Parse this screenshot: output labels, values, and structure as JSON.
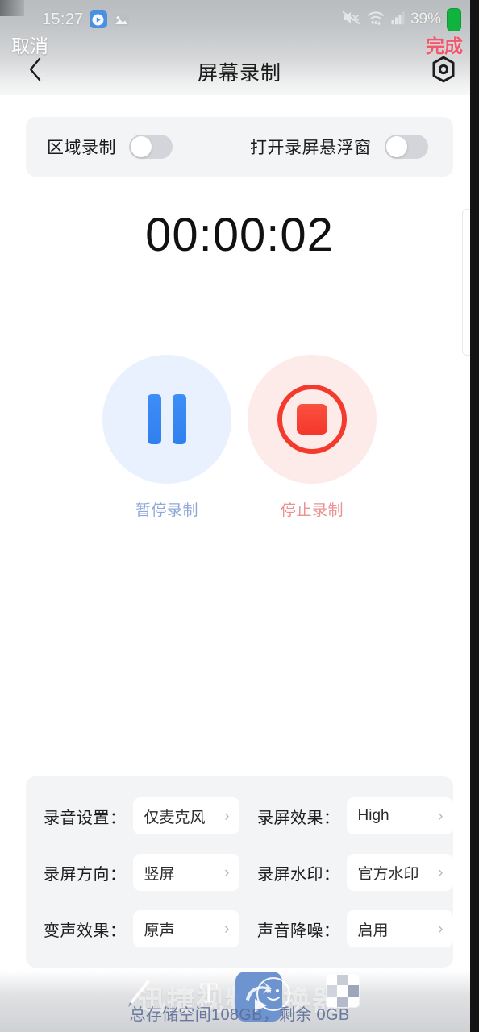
{
  "status_bar": {
    "time": "15:27",
    "app_icon": "screen-record-app-icon",
    "gallery_icon": "image-icon",
    "mute_icon": "volume-mute-icon",
    "wifi_icon": "wifi-data-icon",
    "signal_icon": "cellular-signal-icon",
    "battery_percent": "39%",
    "battery_icon": "battery-full-icon",
    "battery_color": "#11b33f"
  },
  "overlay_actions": {
    "cancel_label": "取消",
    "done_label": "完成",
    "done_color": "#f4566b"
  },
  "navbar": {
    "back_icon": "chevron-left-icon",
    "title": "屏幕录制",
    "settings_icon": "gear-hexagon-icon"
  },
  "toggles": [
    {
      "label": "区域录制",
      "value": "off",
      "icon": "toggle-switch-off"
    },
    {
      "label": "打开录屏悬浮窗",
      "value": "off",
      "icon": "toggle-switch-off"
    }
  ],
  "timer": {
    "elapsed": "00:00:02"
  },
  "controls": [
    {
      "label": "暂停录制",
      "icon": "pause-icon",
      "accent": "#2f7ff0",
      "bg": "#e8f1fd",
      "label_color": "#8fa8d8"
    },
    {
      "label": "停止录制",
      "icon": "stop-record-icon",
      "accent": "#f43a2d",
      "bg": "#fdebea",
      "label_color": "#e99193"
    }
  ],
  "settings": {
    "rows": [
      {
        "left": {
          "label": "录音设置：",
          "value": "仅麦克风",
          "chevron": "chevron-right-icon"
        },
        "right": {
          "label": "录屏效果：",
          "value": "High",
          "chevron": "chevron-right-icon"
        }
      },
      {
        "left": {
          "label": "录屏方向：",
          "value": "竖屏",
          "chevron": "chevron-right-icon"
        },
        "right": {
          "label": "录屏水印：",
          "value": "官方水印",
          "chevron": "chevron-right-icon"
        }
      },
      {
        "left": {
          "label": "变声效果：",
          "value": "原声",
          "chevron": "chevron-right-icon"
        },
        "right": {
          "label": "声音降噪：",
          "value": "启用",
          "chevron": "chevron-right-icon"
        }
      }
    ]
  },
  "storage": {
    "text": "总存储空间108GB，剩余 0GB"
  },
  "bottom_overlay": {
    "ghost_brand": "迅捷视频转换器",
    "tools": [
      {
        "icon": "pencil-icon"
      },
      {
        "icon": "text-tool-icon",
        "glyph": "T"
      },
      {
        "icon": "video-app-icon"
      },
      {
        "icon": "smiley-sticker-icon"
      },
      {
        "icon": "mosaic-tool-icon"
      }
    ]
  },
  "edge": {
    "slider_icon": "edge-slider-handle",
    "dark_strip_color": "#141414"
  }
}
